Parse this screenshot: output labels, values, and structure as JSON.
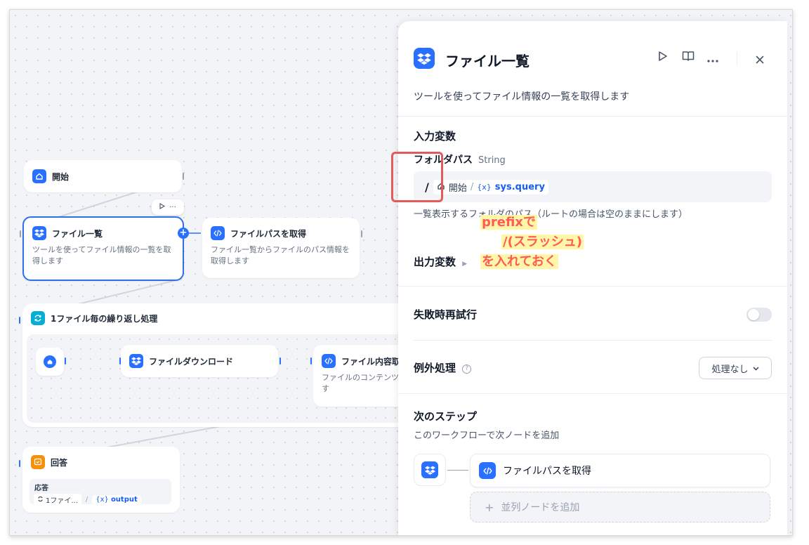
{
  "canvas": {
    "start_node": {
      "title": "開始"
    },
    "file_list_node": {
      "title": "ファイル一覧",
      "desc": "ツールを使ってファイル情報の一覧を取得します",
      "toolbar_more": "···"
    },
    "file_path_node": {
      "title": "ファイルパスを取得",
      "desc": "ファイル一覧からファイルのパス情報を取得します"
    },
    "loop_node": {
      "title": "1ファイル毎の繰り返し処理"
    },
    "download_node": {
      "title": "ファイルダウンロード"
    },
    "content_node": {
      "title": "ファイル内容取",
      "desc": "ファイルのコンテンツ\nす"
    },
    "answer_node": {
      "title": "回答",
      "field_label": "応答",
      "var_source": "1ファイ...",
      "var_name": "output",
      "separator": "/"
    }
  },
  "panel": {
    "title": "ファイル一覧",
    "description": "ツールを使ってファイル情報の一覧を取得します",
    "input_section": "入力変数",
    "folder_path_label": "フォルダパス",
    "folder_path_type": "String",
    "folder_path_prefix": "/",
    "folder_path_source": "開始",
    "folder_path_separator": "/",
    "folder_path_var": "sys.query",
    "folder_path_hint": "一覧表示するフォルダのパス（ルートの場合は空のままにします）",
    "output_section": "出力変数",
    "retry_label": "失敗時再試行",
    "retry_enabled": false,
    "error_label": "例外処理",
    "error_select_value": "処理なし",
    "next_step_title": "次のステップ",
    "next_step_subtitle": "このワークフローで次ノードを追加",
    "next_node_label": "ファイルパスを取得",
    "add_parallel_label": "並列ノードを追加",
    "add_parallel_plus": "+"
  },
  "annotation": {
    "line1": "prefixで",
    "line2": "/(スラッシュ)",
    "line3": "を入れておく"
  },
  "colors": {
    "accent": "#2970ff",
    "highlight_border": "#e25b5b",
    "annotation_text": "#ff5a5a",
    "annotation_bg": "#fff6a8"
  }
}
